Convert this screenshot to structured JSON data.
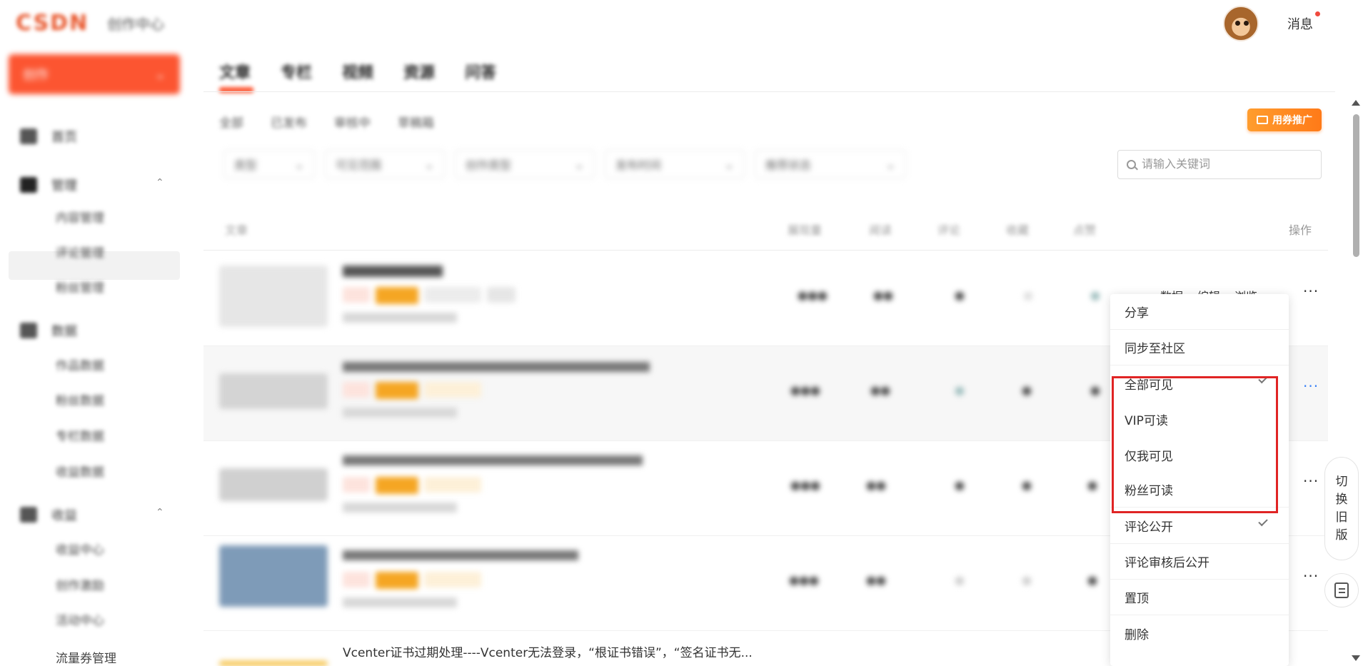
{
  "header": {
    "logo_text": "CSDN",
    "logo_sub": "创作中心",
    "message_label": "消息"
  },
  "sidebar": {
    "create_label": "创作",
    "items": [
      {
        "label": "首页"
      },
      {
        "label": "管理"
      },
      {
        "label": "数据"
      },
      {
        "label": "收益"
      }
    ],
    "sub_items_manage": [
      "内容管理",
      "评论管理",
      "粉丝管理"
    ],
    "sub_items_data": [
      "作品数据",
      "粉丝数据",
      "专栏数据",
      "收益数据"
    ],
    "sub_items_income": [
      "收益中心",
      "创作激励",
      "活动中心"
    ],
    "traffic_label": "流量券管理"
  },
  "tabs": [
    "文章",
    "专栏",
    "视频",
    "资源",
    "问答"
  ],
  "subtabs": [
    "全部",
    "已发布",
    "审核中",
    "草稿箱"
  ],
  "promo_label": "用券推广",
  "filters": [
    "类型",
    "可见范围",
    "创作类型",
    "发布时间",
    "推荐状态"
  ],
  "search": {
    "placeholder": "请输入关键词"
  },
  "table": {
    "headers": [
      "文章",
      "展现量",
      "阅读",
      "评论",
      "收藏",
      "点赞"
    ],
    "op_header": "操作",
    "row_ops": [
      "数据",
      "编辑",
      "浏览"
    ],
    "last_title": "Vcenter证书过期处理----Vcenter无法登录，“根证书错误”，“签名证书无..."
  },
  "menu": {
    "items": [
      {
        "label": "分享",
        "checked": false
      },
      {
        "label": "同步至社区",
        "checked": false
      },
      {
        "label": "全部可见",
        "checked": true
      },
      {
        "label": "VIP可读",
        "checked": false
      },
      {
        "label": "仅我可见",
        "checked": false
      },
      {
        "label": "粉丝可读",
        "checked": false
      },
      {
        "label": "评论公开",
        "checked": true
      },
      {
        "label": "评论审核后公开",
        "checked": false
      },
      {
        "label": "置顶",
        "checked": false
      },
      {
        "label": "删除",
        "checked": false
      }
    ]
  },
  "switch_old": [
    "切",
    "换",
    "旧",
    "版"
  ]
}
